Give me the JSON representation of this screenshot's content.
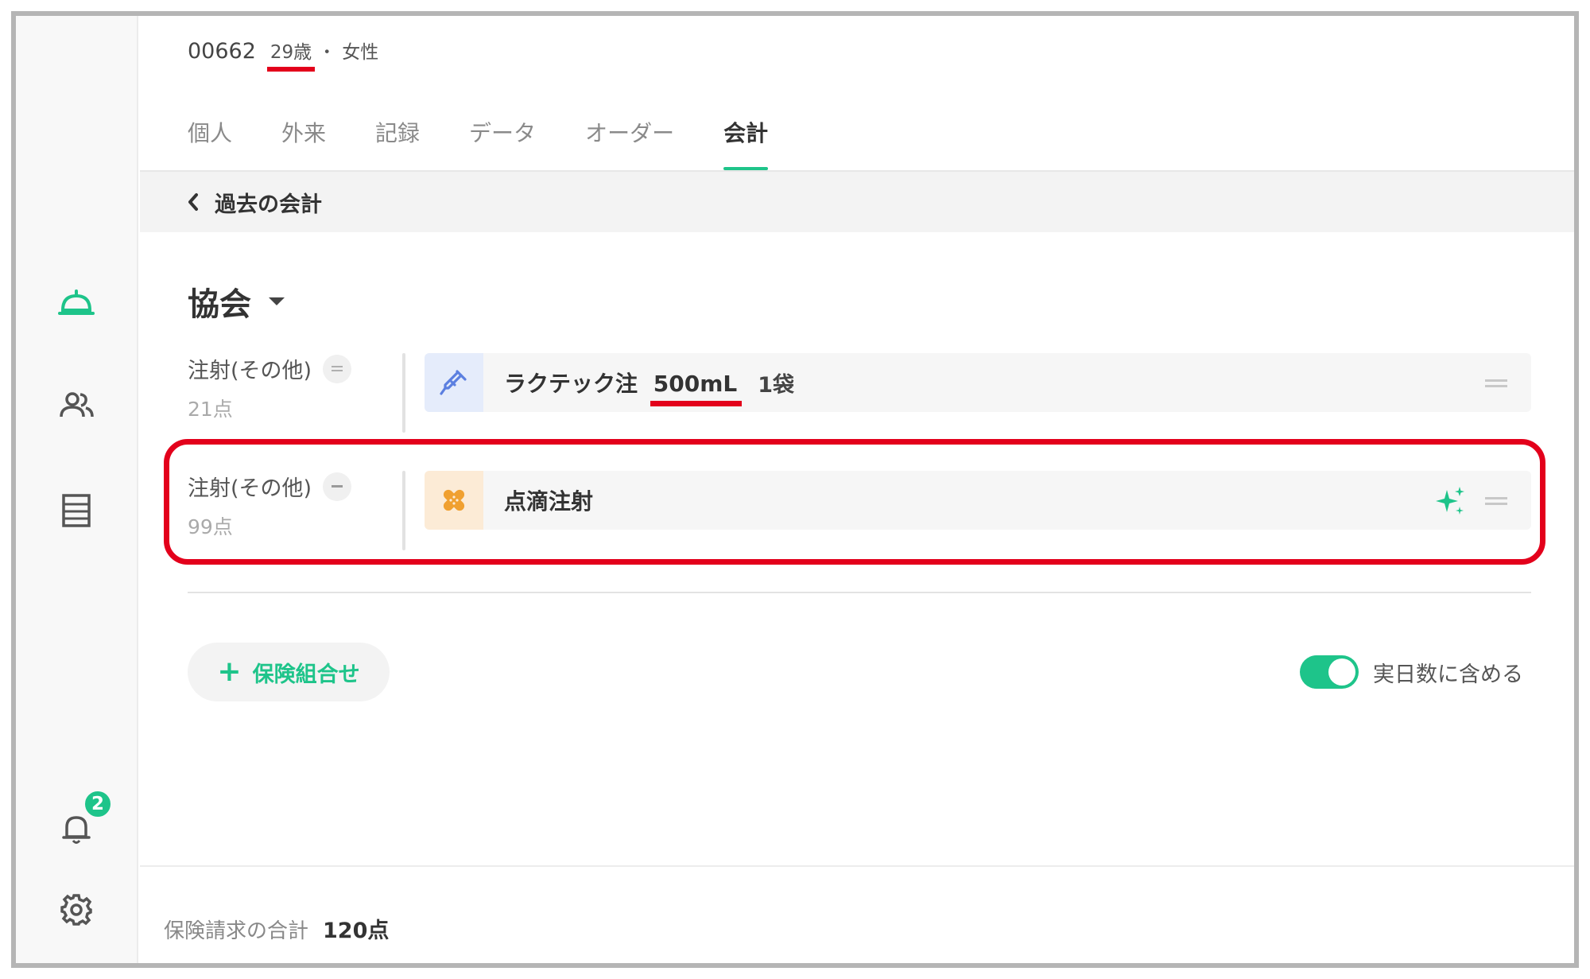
{
  "patient": {
    "id": "00662",
    "age": "29歳",
    "separator": "・",
    "sex": "女性"
  },
  "tabs": [
    {
      "label": "個人"
    },
    {
      "label": "外来"
    },
    {
      "label": "記録"
    },
    {
      "label": "データ"
    },
    {
      "label": "オーダー"
    },
    {
      "label": "会計"
    }
  ],
  "active_tab": "会計",
  "back": {
    "label": "過去の会計"
  },
  "insurer": {
    "name": "協会"
  },
  "orders": [
    {
      "category": "注射(その他)",
      "points": "21点",
      "title": "ラクテック注",
      "volume": "500mL",
      "quantity": "1袋",
      "icon": "syringe-icon"
    },
    {
      "category": "注射(その他)",
      "points": "99点",
      "title": "点滴注射",
      "icon": "bandage-icon"
    }
  ],
  "add_button": {
    "label": "保険組合せ"
  },
  "toggle": {
    "label": "実日数に含める",
    "state": "on"
  },
  "footer": {
    "label": "保険請求の合計",
    "value": "120点"
  },
  "notifications": {
    "count": "2"
  },
  "colors": {
    "accent": "#1ec48a",
    "annotation": "#e3001b",
    "syringe": "#5b7fe0",
    "bandage": "#f0a030"
  },
  "rail_icons": [
    "reception-bell-icon",
    "patients-icon",
    "list-icon",
    "notification-bell-icon",
    "settings-gear-icon"
  ]
}
